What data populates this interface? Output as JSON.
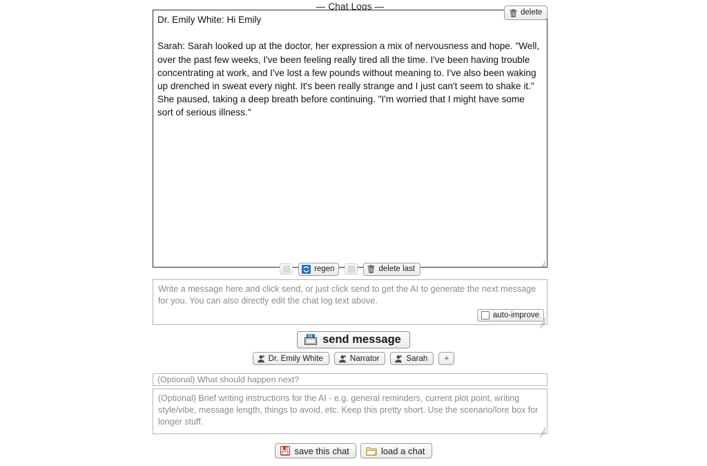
{
  "chat_log": {
    "title": "— Chat Logs —",
    "delete_button_label": "delete",
    "text": "Dr. Emily White: Hi Emily\n\nSarah: Sarah looked up at the doctor, her expression a mix of nervousness and hope. \"Well, over the past few weeks, I've been feeling really tired all the time. I've been having trouble concentrating at work, and I've lost a few pounds without meaning to. I've also been waking up drenched in sweat every night. It's been really strange and I just can't seem to shake it.\" She paused, taking a deep breath before continuing. \"I'm worried that I might have some sort of serious illness.\"",
    "toolbar": {
      "prev_label": "",
      "regen_label": "regen",
      "next_label": "",
      "delete_last_label": "delete last"
    }
  },
  "message_input": {
    "placeholder": "Write a message here and click send, or just click send to get the AI to generate the next message for you. You can also directly edit the chat log text above.",
    "value": "",
    "auto_improve_label": "auto-improve",
    "auto_improve_checked": false
  },
  "send": {
    "label": "send message"
  },
  "characters": {
    "chips": [
      {
        "label": "Dr. Emily White"
      },
      {
        "label": "Narrator"
      },
      {
        "label": "Sarah"
      }
    ],
    "add_label": "+"
  },
  "next_input": {
    "placeholder": "(Optional) What should happen next?",
    "value": ""
  },
  "instructions_input": {
    "placeholder": "(Optional) Brief writing instructions for the AI - e.g. general reminders, current plot point, writing style/vibe, message length, things to avoid, etc. Keep this pretty short. Use the scenario/lore box for longer stuff.",
    "value": ""
  },
  "bottom_actions": {
    "save_label": "save this chat",
    "load_label": "load a chat"
  },
  "colors": {
    "page_background": "#ffffff",
    "chat_border": "#2b2b2b",
    "field_border": "#b4b4b4",
    "placeholder_text": "#8a8a8a",
    "regen_accent": "#1f6fd0",
    "save_accent": "#c0392b",
    "folder_accent": "#e8b84b"
  }
}
